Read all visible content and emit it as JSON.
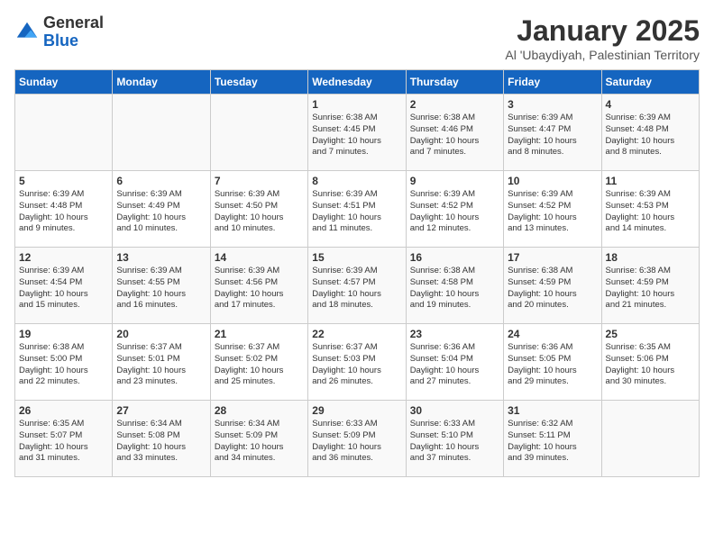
{
  "header": {
    "logo_general": "General",
    "logo_blue": "Blue",
    "title": "January 2025",
    "subtitle": "Al 'Ubaydiyah, Palestinian Territory"
  },
  "weekdays": [
    "Sunday",
    "Monday",
    "Tuesday",
    "Wednesday",
    "Thursday",
    "Friday",
    "Saturday"
  ],
  "weeks": [
    [
      {
        "day": "",
        "info": ""
      },
      {
        "day": "",
        "info": ""
      },
      {
        "day": "",
        "info": ""
      },
      {
        "day": "1",
        "info": "Sunrise: 6:38 AM\nSunset: 4:45 PM\nDaylight: 10 hours\nand 7 minutes."
      },
      {
        "day": "2",
        "info": "Sunrise: 6:38 AM\nSunset: 4:46 PM\nDaylight: 10 hours\nand 7 minutes."
      },
      {
        "day": "3",
        "info": "Sunrise: 6:39 AM\nSunset: 4:47 PM\nDaylight: 10 hours\nand 8 minutes."
      },
      {
        "day": "4",
        "info": "Sunrise: 6:39 AM\nSunset: 4:48 PM\nDaylight: 10 hours\nand 8 minutes."
      }
    ],
    [
      {
        "day": "5",
        "info": "Sunrise: 6:39 AM\nSunset: 4:48 PM\nDaylight: 10 hours\nand 9 minutes."
      },
      {
        "day": "6",
        "info": "Sunrise: 6:39 AM\nSunset: 4:49 PM\nDaylight: 10 hours\nand 10 minutes."
      },
      {
        "day": "7",
        "info": "Sunrise: 6:39 AM\nSunset: 4:50 PM\nDaylight: 10 hours\nand 10 minutes."
      },
      {
        "day": "8",
        "info": "Sunrise: 6:39 AM\nSunset: 4:51 PM\nDaylight: 10 hours\nand 11 minutes."
      },
      {
        "day": "9",
        "info": "Sunrise: 6:39 AM\nSunset: 4:52 PM\nDaylight: 10 hours\nand 12 minutes."
      },
      {
        "day": "10",
        "info": "Sunrise: 6:39 AM\nSunset: 4:52 PM\nDaylight: 10 hours\nand 13 minutes."
      },
      {
        "day": "11",
        "info": "Sunrise: 6:39 AM\nSunset: 4:53 PM\nDaylight: 10 hours\nand 14 minutes."
      }
    ],
    [
      {
        "day": "12",
        "info": "Sunrise: 6:39 AM\nSunset: 4:54 PM\nDaylight: 10 hours\nand 15 minutes."
      },
      {
        "day": "13",
        "info": "Sunrise: 6:39 AM\nSunset: 4:55 PM\nDaylight: 10 hours\nand 16 minutes."
      },
      {
        "day": "14",
        "info": "Sunrise: 6:39 AM\nSunset: 4:56 PM\nDaylight: 10 hours\nand 17 minutes."
      },
      {
        "day": "15",
        "info": "Sunrise: 6:39 AM\nSunset: 4:57 PM\nDaylight: 10 hours\nand 18 minutes."
      },
      {
        "day": "16",
        "info": "Sunrise: 6:38 AM\nSunset: 4:58 PM\nDaylight: 10 hours\nand 19 minutes."
      },
      {
        "day": "17",
        "info": "Sunrise: 6:38 AM\nSunset: 4:59 PM\nDaylight: 10 hours\nand 20 minutes."
      },
      {
        "day": "18",
        "info": "Sunrise: 6:38 AM\nSunset: 4:59 PM\nDaylight: 10 hours\nand 21 minutes."
      }
    ],
    [
      {
        "day": "19",
        "info": "Sunrise: 6:38 AM\nSunset: 5:00 PM\nDaylight: 10 hours\nand 22 minutes."
      },
      {
        "day": "20",
        "info": "Sunrise: 6:37 AM\nSunset: 5:01 PM\nDaylight: 10 hours\nand 23 minutes."
      },
      {
        "day": "21",
        "info": "Sunrise: 6:37 AM\nSunset: 5:02 PM\nDaylight: 10 hours\nand 25 minutes."
      },
      {
        "day": "22",
        "info": "Sunrise: 6:37 AM\nSunset: 5:03 PM\nDaylight: 10 hours\nand 26 minutes."
      },
      {
        "day": "23",
        "info": "Sunrise: 6:36 AM\nSunset: 5:04 PM\nDaylight: 10 hours\nand 27 minutes."
      },
      {
        "day": "24",
        "info": "Sunrise: 6:36 AM\nSunset: 5:05 PM\nDaylight: 10 hours\nand 29 minutes."
      },
      {
        "day": "25",
        "info": "Sunrise: 6:35 AM\nSunset: 5:06 PM\nDaylight: 10 hours\nand 30 minutes."
      }
    ],
    [
      {
        "day": "26",
        "info": "Sunrise: 6:35 AM\nSunset: 5:07 PM\nDaylight: 10 hours\nand 31 minutes."
      },
      {
        "day": "27",
        "info": "Sunrise: 6:34 AM\nSunset: 5:08 PM\nDaylight: 10 hours\nand 33 minutes."
      },
      {
        "day": "28",
        "info": "Sunrise: 6:34 AM\nSunset: 5:09 PM\nDaylight: 10 hours\nand 34 minutes."
      },
      {
        "day": "29",
        "info": "Sunrise: 6:33 AM\nSunset: 5:09 PM\nDaylight: 10 hours\nand 36 minutes."
      },
      {
        "day": "30",
        "info": "Sunrise: 6:33 AM\nSunset: 5:10 PM\nDaylight: 10 hours\nand 37 minutes."
      },
      {
        "day": "31",
        "info": "Sunrise: 6:32 AM\nSunset: 5:11 PM\nDaylight: 10 hours\nand 39 minutes."
      },
      {
        "day": "",
        "info": ""
      }
    ]
  ]
}
